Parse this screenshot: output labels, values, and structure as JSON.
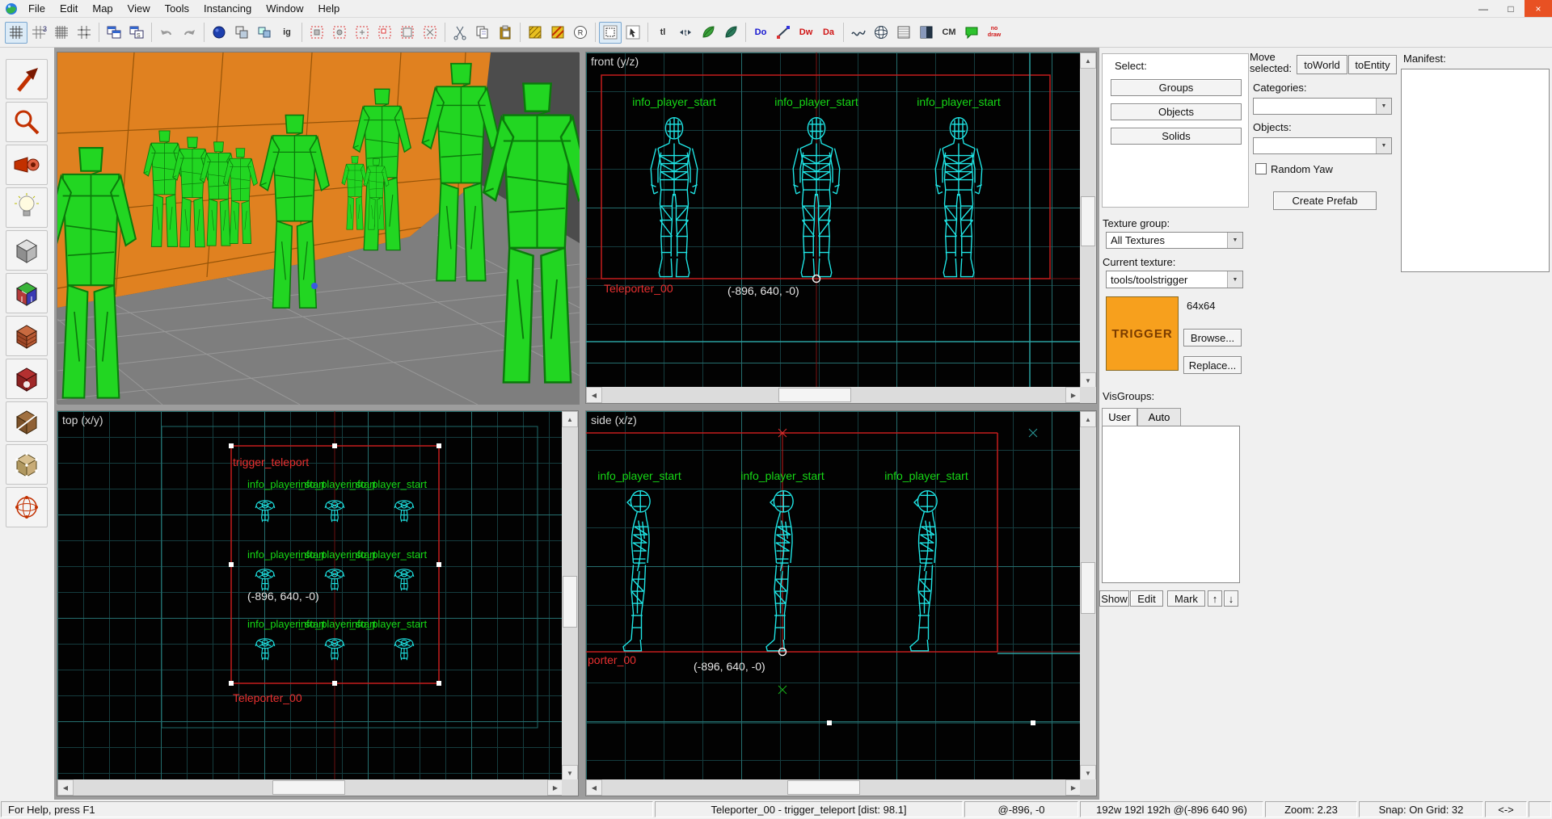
{
  "window": {
    "menu_items": [
      "File",
      "Edit",
      "Map",
      "View",
      "Tools",
      "Instancing",
      "Window",
      "Help"
    ],
    "minimize_glyph": "—",
    "maximize_glyph": "□",
    "close_glyph": "×"
  },
  "toolbar_text": {
    "grid3": "3",
    "ig": "ig",
    "r": "R",
    "tl": "tl",
    "t": "t",
    "do": "Do",
    "dw": "Dw",
    "da": "Da",
    "cm": "CM",
    "nodraw_1": "no",
    "nodraw_2": "draw"
  },
  "icons": {
    "up": "▲",
    "down": "▼",
    "left": "◀",
    "right": "▶",
    "combo_arrow": "▼",
    "list_up": "↑",
    "list_down": "↓"
  },
  "viewports": {
    "front": {
      "title": "front (y/z)",
      "entity_label": "info_player_start",
      "brush_label": "Teleporter_00",
      "coords": "(-896, 640, -0)"
    },
    "top": {
      "title": "top (x/y)",
      "trigger_label": "trigger_teleport",
      "entity_label": "info_player_start",
      "brush_label": "Teleporter_00",
      "coords": "(-896, 640, -0)"
    },
    "side": {
      "title": "side (x/z)",
      "entity_label": "info_player_start",
      "brush_label_clipped": "porter_00",
      "coords": "(-896, 640, -0)"
    }
  },
  "panel": {
    "select_label": "Select:",
    "groups": "Groups",
    "objects": "Objects",
    "solids": "Solids",
    "move_line1": "Move",
    "move_line2": "selected:",
    "to_world": "toWorld",
    "to_entity": "toEntity",
    "manifest_label": "Manifest:",
    "categories_label": "Categories:",
    "objects_label": "Objects:",
    "random_yaw": "Random Yaw",
    "create_prefab": "Create Prefab",
    "texture_group_label": "Texture group:",
    "texture_group_value": "All Textures",
    "current_texture_label": "Current texture:",
    "current_texture_value": "tools/toolstrigger",
    "texture_preview_text": "TRIGGER",
    "texture_size": "64x64",
    "browse": "Browse...",
    "replace": "Replace...",
    "visgroups_label": "VisGroups:",
    "tab_user": "User",
    "tab_auto": "Auto",
    "show": "Show",
    "edit": "Edit",
    "mark": "Mark"
  },
  "statusbar": {
    "help": "For Help, press F1",
    "selection": "Teleporter_00 - trigger_teleport  [dist: 98.1]",
    "position": "@-896, -0",
    "dimensions": "192w 192l 192h @(-896 640 96)",
    "zoom": "Zoom: 2.23",
    "snap": "Snap: On Grid: 32",
    "arrows": "<->"
  }
}
